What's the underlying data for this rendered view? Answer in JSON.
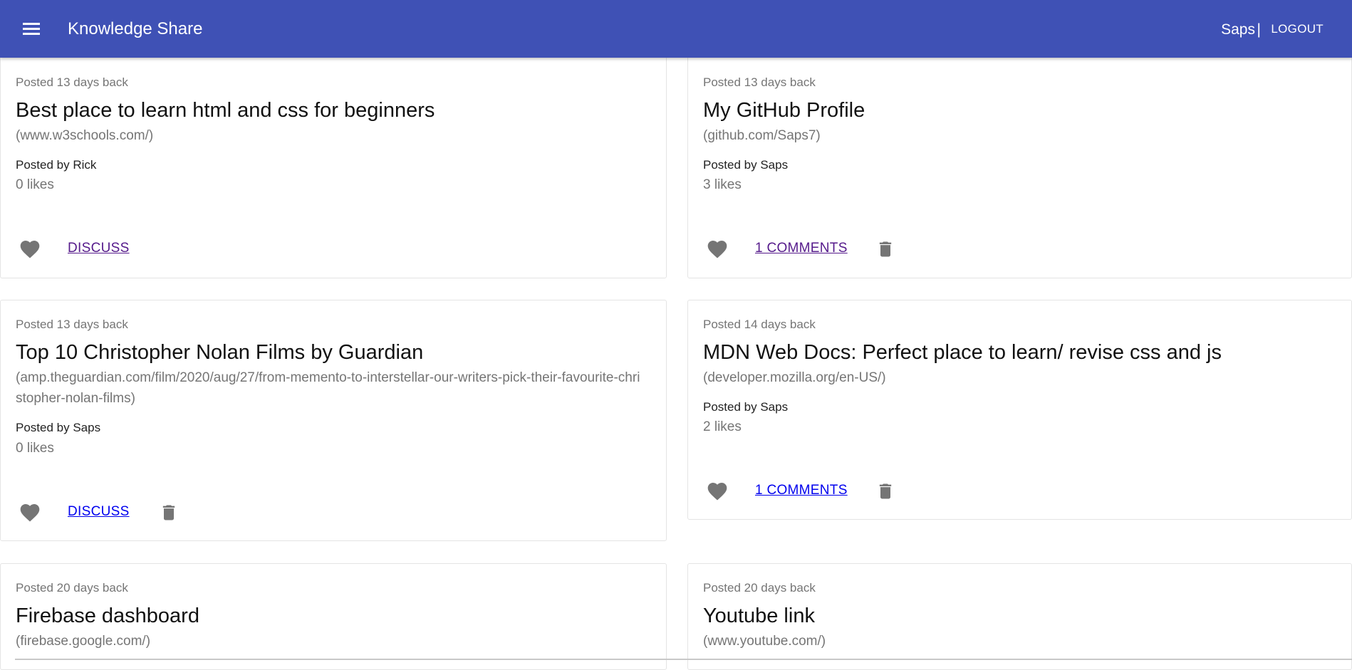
{
  "header": {
    "title": "Knowledge Share",
    "user": "Saps",
    "separator": "|",
    "logout_label": "LOGOUT"
  },
  "posts": [
    {
      "time": "Posted 13 days back",
      "title": "Best place to learn html and css for beginners",
      "link": "(www.w3schools.com/)",
      "author": "Posted by Rick",
      "likes": "0 likes",
      "discuss_label": "DISCUSS"
    },
    {
      "time": "Posted 13 days back",
      "title": "My GitHub Profile",
      "link": "(github.com/Saps7)",
      "author": "Posted by Saps",
      "likes": "3 likes",
      "discuss_label": "1 COMMENTS"
    },
    {
      "time": "Posted 13 days back",
      "title": "Top 10 Christopher Nolan Films by Guardian",
      "link": "(amp.theguardian.com/film/2020/aug/27/from-memento-to-interstellar-our-writers-pick-their-favourite-christopher-nolan-films)",
      "author": "Posted by Saps",
      "likes": "0 likes",
      "discuss_label": "DISCUSS"
    },
    {
      "time": "Posted 14 days back",
      "title": "MDN Web Docs: Perfect place to learn/ revise css and js",
      "link": "(developer.mozilla.org/en-US/)",
      "author": "Posted by Saps",
      "likes": "2 likes",
      "discuss_label": "1 COMMENTS"
    },
    {
      "time": "Posted 20 days back",
      "title": "Firebase dashboard",
      "link": "(firebase.google.com/)"
    },
    {
      "time": "Posted 20 days back",
      "title": "Youtube link",
      "link": "(www.youtube.com/)"
    }
  ],
  "icons": {
    "menu": "menu-icon",
    "like": "heart-icon",
    "delete": "trash-icon"
  },
  "colors": {
    "appbar": "#3f51b5",
    "icon_gray": "#757575",
    "link_visited": "#551a8b",
    "link_unvisited": "#0000ee"
  }
}
